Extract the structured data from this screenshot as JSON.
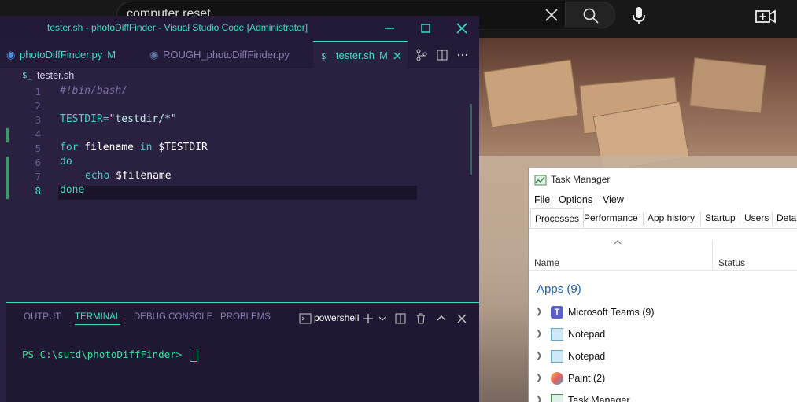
{
  "youtube": {
    "search_value": "computer reset",
    "colors": {
      "bg": "#181818"
    }
  },
  "vscode": {
    "title": "tester.sh - photoDiffFinder - Visual Studio Code [Administrator]",
    "tabs": [
      {
        "label": "photoDiffFinder.py",
        "badge": "M",
        "icon": "python-icon",
        "active": false
      },
      {
        "label": "ROUGH_photoDiffFinder.py",
        "badge": "",
        "icon": "python-icon",
        "active": false
      },
      {
        "label": "tester.sh",
        "badge": "M",
        "icon": "shell-icon",
        "active": true
      }
    ],
    "breadcrumb": {
      "icon": "$_",
      "file": "tester.sh"
    },
    "code": {
      "line_numbers": [
        "1",
        "2",
        "3",
        "4",
        "5",
        "6",
        "7",
        "8"
      ],
      "l1": "#!bin/bash/",
      "l3_var": "TESTDIR=",
      "l3_str": "\"testdir/*\"",
      "l5_kw1": "for",
      "l5_name": " filename ",
      "l5_kw2": "in",
      "l5_var": " $TESTDIR",
      "l6": "do",
      "l7_kw": "echo",
      "l7_var": " $filename",
      "l8": "done"
    },
    "panel": {
      "tabs": [
        "OUTPUT",
        "TERMINAL",
        "DEBUG CONSOLE",
        "PROBLEMS"
      ],
      "active_tab": "TERMINAL",
      "shell": "powershell",
      "prompt": "PS C:\\sutd\\photoDiffFinder> "
    },
    "colors": {
      "accent": "#35e0c0",
      "bg": "#2a2040"
    }
  },
  "taskmgr": {
    "title": "Task Manager",
    "menu": [
      "File",
      "Options",
      "View"
    ],
    "tabs": [
      "Processes",
      "Performance",
      "App history",
      "Startup",
      "Users",
      "Detai"
    ],
    "columns": {
      "name": "Name",
      "status": "Status"
    },
    "group": "Apps (9)",
    "rows": [
      {
        "label": "Microsoft Teams (9)",
        "icon": "teams-icon"
      },
      {
        "label": "Notepad",
        "icon": "notepad-icon"
      },
      {
        "label": "Notepad",
        "icon": "notepad-icon"
      },
      {
        "label": "Paint (2)",
        "icon": "paint-icon"
      },
      {
        "label": "Task Manager",
        "icon": "taskmgr-icon"
      }
    ]
  }
}
